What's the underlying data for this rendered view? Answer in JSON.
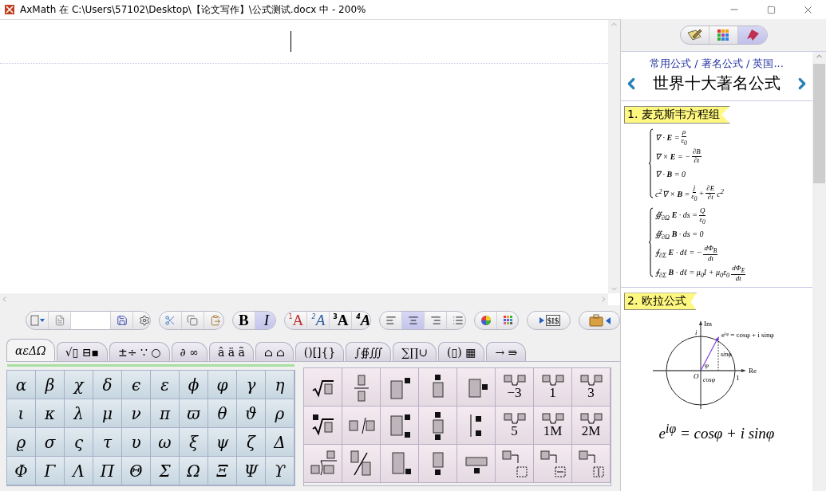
{
  "window": {
    "title": "AxMath 在 C:\\Users\\57102\\Desktop\\【论文写作】\\公式测试.docx 中 - 200%"
  },
  "toolbar": {
    "groups": [
      {
        "buttons": [
          {
            "kind": "dropdown",
            "selected": false
          },
          {
            "kind": "document",
            "selected": false
          },
          {
            "kind": "blank",
            "selected": false
          },
          {
            "kind": "save",
            "selected": false
          },
          {
            "kind": "settings",
            "selected": false
          }
        ]
      },
      {
        "buttons": [
          {
            "kind": "cut",
            "selected": false
          },
          {
            "kind": "copy",
            "selected": false
          },
          {
            "kind": "paste",
            "selected": false
          }
        ]
      },
      {
        "buttons": [
          {
            "kind": "bold",
            "label": "B",
            "selected": false
          },
          {
            "kind": "italic",
            "label": "I",
            "selected": true
          }
        ]
      },
      {
        "buttons": [
          {
            "kind": "font",
            "label": "A",
            "mark": "1",
            "color": "#c03030",
            "selected": false
          },
          {
            "kind": "font",
            "label": "A",
            "mark": "2",
            "color": "#3060a0",
            "selected": false
          },
          {
            "kind": "font",
            "label": "A",
            "mark": "3",
            "color": "#000000",
            "selected": false
          },
          {
            "kind": "font",
            "label": "A",
            "mark": "4",
            "color": "#000000",
            "selected": false
          }
        ]
      },
      {
        "buttons": [
          {
            "kind": "align-left",
            "selected": false
          },
          {
            "kind": "align-center",
            "selected": true
          },
          {
            "kind": "align-right",
            "selected": false
          },
          {
            "kind": "list",
            "selected": false
          }
        ]
      },
      {
        "buttons": [
          {
            "kind": "color",
            "selected": false
          },
          {
            "kind": "palette",
            "selected": false
          }
        ]
      },
      {
        "buttons": [
          {
            "kind": "inline-math",
            "label": "$I$",
            "selected": false
          }
        ]
      },
      {
        "buttons": [
          {
            "kind": "toolbox",
            "selected": false
          }
        ]
      }
    ]
  },
  "tabs": [
    {
      "label": "αεΔΩ",
      "selected": true
    },
    {
      "label": "√▯ ⊟▪",
      "selected": false
    },
    {
      "label": "±÷ ∵ ○",
      "selected": false
    },
    {
      "label": "∂ ∞",
      "selected": false
    },
    {
      "label": "â ä ã",
      "selected": false
    },
    {
      "label": "⌂ ⌂",
      "selected": false
    },
    {
      "label": "()[]{}",
      "selected": false
    },
    {
      "label": "∫∯∭",
      "selected": false
    },
    {
      "label": "∑∏∪",
      "selected": false
    },
    {
      "label": "(▯) ▦",
      "selected": false
    },
    {
      "label": "→ ⇛",
      "selected": false
    }
  ],
  "symbols": [
    "α",
    "β",
    "χ",
    "δ",
    "ϵ",
    "ε",
    "ϕ",
    "φ",
    "γ",
    "η",
    "ι",
    "κ",
    "λ",
    "μ",
    "ν",
    "π",
    "ϖ",
    "θ",
    "ϑ",
    "ρ",
    "ϱ",
    "σ",
    "ς",
    "τ",
    "υ",
    "ω",
    "ξ",
    "ψ",
    "ζ",
    "Δ",
    "Φ",
    "Γ",
    "Λ",
    "Π",
    "Θ",
    "Σ",
    "Ω",
    "Ξ",
    "Ψ",
    "ϒ"
  ],
  "templates": [
    {
      "kind": "sqrt"
    },
    {
      "kind": "frac"
    },
    {
      "kind": "sup"
    },
    {
      "kind": "over"
    },
    {
      "kind": "right"
    },
    {
      "kind": "space",
      "label": "−3"
    },
    {
      "kind": "space",
      "label": "1"
    },
    {
      "kind": "space",
      "label": "3"
    },
    {
      "kind": "nthroot"
    },
    {
      "kind": "slash"
    },
    {
      "kind": "supsub"
    },
    {
      "kind": "overunder"
    },
    {
      "kind": "bar"
    },
    {
      "kind": "space",
      "label": "5"
    },
    {
      "kind": "space",
      "label": "1M"
    },
    {
      "kind": "space",
      "label": "2M"
    },
    {
      "kind": "longdiv"
    },
    {
      "kind": "bigslash"
    },
    {
      "kind": "sub"
    },
    {
      "kind": "under"
    },
    {
      "kind": "underbar"
    },
    {
      "kind": "break"
    },
    {
      "kind": "break-h"
    },
    {
      "kind": "break-v"
    }
  ],
  "side_panel": {
    "modes": [
      {
        "kind": "notes",
        "selected": false
      },
      {
        "kind": "grid",
        "selected": false
      },
      {
        "kind": "bookmark",
        "selected": true
      }
    ],
    "breadcrumb": "常用公式 / 著名公式 / 英国...",
    "title": "世界十大著名公式",
    "sections": [
      {
        "kind": "equations",
        "heading": "1. 麦克斯韦方程组",
        "groups": [
          [
            [
              {
                "t": "∇ · **E** ="
              },
              {
                "n": "ρ",
                "d": "ε$_{0}$"
              }
            ],
            [
              {
                "t": "∇ × **E** = −"
              },
              {
                "n": "∂B",
                "d": "∂t"
              }
            ],
            [
              {
                "t": "∇ · **B** = 0"
              }
            ],
            [
              {
                "t": "c$^{2}$∇ × **B** ="
              },
              {
                "n": "j",
                "d": "ε$_{0}$"
              },
              {
                "t": "+"
              },
              {
                "n": "∂E",
                "d": "∂t"
              },
              {
                "t": "c$^{2}$"
              }
            ]
          ],
          [
            [
              {
                "t": "∯$_{∂Ω}$ **E** · ds ="
              },
              {
                "n": "Q",
                "d": "ε$_{0}$"
              }
            ],
            [
              {
                "t": "∯$_{∂Ω}$ **B** · ds = 0"
              }
            ],
            [
              {
                "t": "∮$_{∂Σ}$ **E** · dℓ = −"
              },
              {
                "n": "dΦ$_{B}$",
                "d": "dt"
              }
            ],
            [
              {
                "t": "∮$_{∂Σ}$ **B** · dℓ = μ$_{0}$I + μ$_{0}$ε$_{0}$"
              },
              {
                "n": "dΦ$_{E}$",
                "d": "dt"
              }
            ]
          ]
        ]
      },
      {
        "kind": "diagram",
        "heading": "2. 欧拉公式",
        "labels": {
          "im": "Im",
          "re": "Re",
          "i": "i",
          "one": "1",
          "origin": "O",
          "angle": "φ",
          "cos": "cosφ",
          "sin": "sinφ",
          "point": "eⁱᵠ = cosφ + i sinφ"
        },
        "formula": "e$^{iφ}$ = cosφ + i sinφ"
      }
    ]
  }
}
